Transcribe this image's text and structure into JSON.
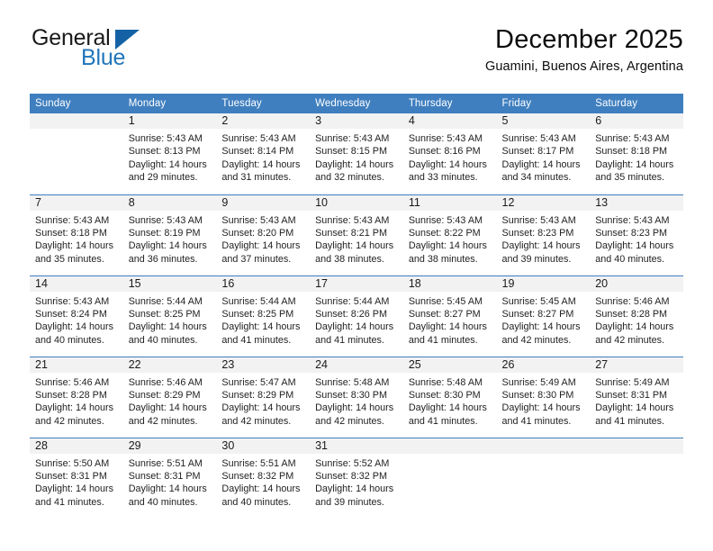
{
  "brand": {
    "name_part1": "General",
    "name_part2": "Blue",
    "triangle_color": "#1462a5",
    "blue_color": "#2175bb"
  },
  "header": {
    "title": "December 2025",
    "location": "Guamini, Buenos Aires, Argentina"
  },
  "theme": {
    "header_row_bg": "#3f7fbf",
    "daynum_bg": "#f2f2f2",
    "grid_line": "#3f7fbf",
    "text": "#1f1f1f"
  },
  "weekdays": [
    "Sunday",
    "Monday",
    "Tuesday",
    "Wednesday",
    "Thursday",
    "Friday",
    "Saturday"
  ],
  "weeks": [
    [
      {
        "day": "",
        "sunrise": "",
        "sunset": "",
        "daylight_line1": "",
        "daylight_line2": ""
      },
      {
        "day": "1",
        "sunrise": "Sunrise: 5:43 AM",
        "sunset": "Sunset: 8:13 PM",
        "daylight_line1": "Daylight: 14 hours",
        "daylight_line2": "and 29 minutes."
      },
      {
        "day": "2",
        "sunrise": "Sunrise: 5:43 AM",
        "sunset": "Sunset: 8:14 PM",
        "daylight_line1": "Daylight: 14 hours",
        "daylight_line2": "and 31 minutes."
      },
      {
        "day": "3",
        "sunrise": "Sunrise: 5:43 AM",
        "sunset": "Sunset: 8:15 PM",
        "daylight_line1": "Daylight: 14 hours",
        "daylight_line2": "and 32 minutes."
      },
      {
        "day": "4",
        "sunrise": "Sunrise: 5:43 AM",
        "sunset": "Sunset: 8:16 PM",
        "daylight_line1": "Daylight: 14 hours",
        "daylight_line2": "and 33 minutes."
      },
      {
        "day": "5",
        "sunrise": "Sunrise: 5:43 AM",
        "sunset": "Sunset: 8:17 PM",
        "daylight_line1": "Daylight: 14 hours",
        "daylight_line2": "and 34 minutes."
      },
      {
        "day": "6",
        "sunrise": "Sunrise: 5:43 AM",
        "sunset": "Sunset: 8:18 PM",
        "daylight_line1": "Daylight: 14 hours",
        "daylight_line2": "and 35 minutes."
      }
    ],
    [
      {
        "day": "7",
        "sunrise": "Sunrise: 5:43 AM",
        "sunset": "Sunset: 8:18 PM",
        "daylight_line1": "Daylight: 14 hours",
        "daylight_line2": "and 35 minutes."
      },
      {
        "day": "8",
        "sunrise": "Sunrise: 5:43 AM",
        "sunset": "Sunset: 8:19 PM",
        "daylight_line1": "Daylight: 14 hours",
        "daylight_line2": "and 36 minutes."
      },
      {
        "day": "9",
        "sunrise": "Sunrise: 5:43 AM",
        "sunset": "Sunset: 8:20 PM",
        "daylight_line1": "Daylight: 14 hours",
        "daylight_line2": "and 37 minutes."
      },
      {
        "day": "10",
        "sunrise": "Sunrise: 5:43 AM",
        "sunset": "Sunset: 8:21 PM",
        "daylight_line1": "Daylight: 14 hours",
        "daylight_line2": "and 38 minutes."
      },
      {
        "day": "11",
        "sunrise": "Sunrise: 5:43 AM",
        "sunset": "Sunset: 8:22 PM",
        "daylight_line1": "Daylight: 14 hours",
        "daylight_line2": "and 38 minutes."
      },
      {
        "day": "12",
        "sunrise": "Sunrise: 5:43 AM",
        "sunset": "Sunset: 8:23 PM",
        "daylight_line1": "Daylight: 14 hours",
        "daylight_line2": "and 39 minutes."
      },
      {
        "day": "13",
        "sunrise": "Sunrise: 5:43 AM",
        "sunset": "Sunset: 8:23 PM",
        "daylight_line1": "Daylight: 14 hours",
        "daylight_line2": "and 40 minutes."
      }
    ],
    [
      {
        "day": "14",
        "sunrise": "Sunrise: 5:43 AM",
        "sunset": "Sunset: 8:24 PM",
        "daylight_line1": "Daylight: 14 hours",
        "daylight_line2": "and 40 minutes."
      },
      {
        "day": "15",
        "sunrise": "Sunrise: 5:44 AM",
        "sunset": "Sunset: 8:25 PM",
        "daylight_line1": "Daylight: 14 hours",
        "daylight_line2": "and 40 minutes."
      },
      {
        "day": "16",
        "sunrise": "Sunrise: 5:44 AM",
        "sunset": "Sunset: 8:25 PM",
        "daylight_line1": "Daylight: 14 hours",
        "daylight_line2": "and 41 minutes."
      },
      {
        "day": "17",
        "sunrise": "Sunrise: 5:44 AM",
        "sunset": "Sunset: 8:26 PM",
        "daylight_line1": "Daylight: 14 hours",
        "daylight_line2": "and 41 minutes."
      },
      {
        "day": "18",
        "sunrise": "Sunrise: 5:45 AM",
        "sunset": "Sunset: 8:27 PM",
        "daylight_line1": "Daylight: 14 hours",
        "daylight_line2": "and 41 minutes."
      },
      {
        "day": "19",
        "sunrise": "Sunrise: 5:45 AM",
        "sunset": "Sunset: 8:27 PM",
        "daylight_line1": "Daylight: 14 hours",
        "daylight_line2": "and 42 minutes."
      },
      {
        "day": "20",
        "sunrise": "Sunrise: 5:46 AM",
        "sunset": "Sunset: 8:28 PM",
        "daylight_line1": "Daylight: 14 hours",
        "daylight_line2": "and 42 minutes."
      }
    ],
    [
      {
        "day": "21",
        "sunrise": "Sunrise: 5:46 AM",
        "sunset": "Sunset: 8:28 PM",
        "daylight_line1": "Daylight: 14 hours",
        "daylight_line2": "and 42 minutes."
      },
      {
        "day": "22",
        "sunrise": "Sunrise: 5:46 AM",
        "sunset": "Sunset: 8:29 PM",
        "daylight_line1": "Daylight: 14 hours",
        "daylight_line2": "and 42 minutes."
      },
      {
        "day": "23",
        "sunrise": "Sunrise: 5:47 AM",
        "sunset": "Sunset: 8:29 PM",
        "daylight_line1": "Daylight: 14 hours",
        "daylight_line2": "and 42 minutes."
      },
      {
        "day": "24",
        "sunrise": "Sunrise: 5:48 AM",
        "sunset": "Sunset: 8:30 PM",
        "daylight_line1": "Daylight: 14 hours",
        "daylight_line2": "and 42 minutes."
      },
      {
        "day": "25",
        "sunrise": "Sunrise: 5:48 AM",
        "sunset": "Sunset: 8:30 PM",
        "daylight_line1": "Daylight: 14 hours",
        "daylight_line2": "and 41 minutes."
      },
      {
        "day": "26",
        "sunrise": "Sunrise: 5:49 AM",
        "sunset": "Sunset: 8:30 PM",
        "daylight_line1": "Daylight: 14 hours",
        "daylight_line2": "and 41 minutes."
      },
      {
        "day": "27",
        "sunrise": "Sunrise: 5:49 AM",
        "sunset": "Sunset: 8:31 PM",
        "daylight_line1": "Daylight: 14 hours",
        "daylight_line2": "and 41 minutes."
      }
    ],
    [
      {
        "day": "28",
        "sunrise": "Sunrise: 5:50 AM",
        "sunset": "Sunset: 8:31 PM",
        "daylight_line1": "Daylight: 14 hours",
        "daylight_line2": "and 41 minutes."
      },
      {
        "day": "29",
        "sunrise": "Sunrise: 5:51 AM",
        "sunset": "Sunset: 8:31 PM",
        "daylight_line1": "Daylight: 14 hours",
        "daylight_line2": "and 40 minutes."
      },
      {
        "day": "30",
        "sunrise": "Sunrise: 5:51 AM",
        "sunset": "Sunset: 8:32 PM",
        "daylight_line1": "Daylight: 14 hours",
        "daylight_line2": "and 40 minutes."
      },
      {
        "day": "31",
        "sunrise": "Sunrise: 5:52 AM",
        "sunset": "Sunset: 8:32 PM",
        "daylight_line1": "Daylight: 14 hours",
        "daylight_line2": "and 39 minutes."
      },
      {
        "day": "",
        "sunrise": "",
        "sunset": "",
        "daylight_line1": "",
        "daylight_line2": ""
      },
      {
        "day": "",
        "sunrise": "",
        "sunset": "",
        "daylight_line1": "",
        "daylight_line2": ""
      },
      {
        "day": "",
        "sunrise": "",
        "sunset": "",
        "daylight_line1": "",
        "daylight_line2": ""
      }
    ]
  ]
}
